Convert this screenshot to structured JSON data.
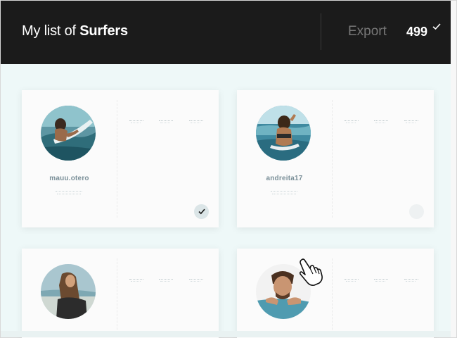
{
  "header": {
    "title_prefix": "My list of",
    "title_bold": "Surfers",
    "export_label": "Export",
    "count": "499"
  },
  "cards": [
    {
      "username": "mauu.otero",
      "selected": true,
      "avatar_icon": "surfer-photo-1"
    },
    {
      "username": "andreita17",
      "selected": false,
      "avatar_icon": "surfer-photo-2"
    },
    {
      "username": "",
      "selected": false,
      "avatar_icon": "surfer-photo-3"
    },
    {
      "username": "",
      "selected": false,
      "avatar_icon": "surfer-photo-4"
    }
  ],
  "colors": {
    "header_bg": "#1b1b1b",
    "page_bg": "#eef8f8",
    "card_bg": "#fbfbfb",
    "username": "#7a8f98"
  }
}
